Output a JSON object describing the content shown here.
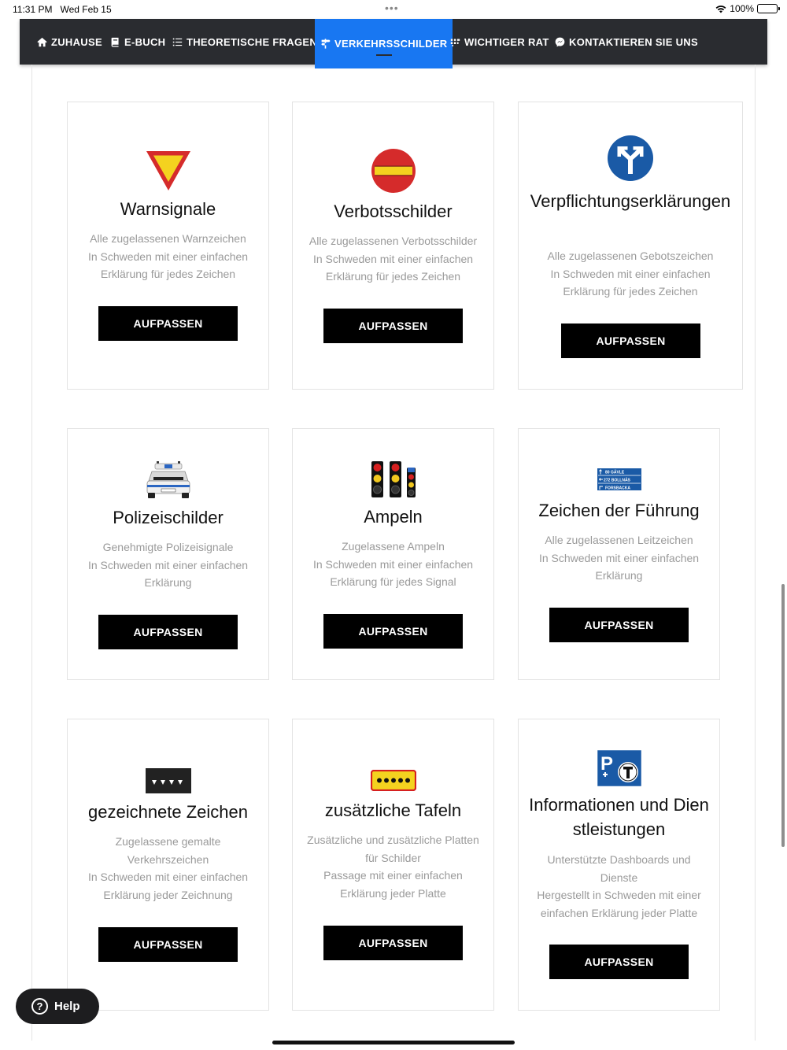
{
  "status_bar": {
    "time": "11:31 PM",
    "date": "Wed Feb 15",
    "battery": "100%"
  },
  "nav": {
    "items": [
      {
        "label": "ZUHAUSE",
        "icon": "home-icon"
      },
      {
        "label": "E-BUCH",
        "icon": "book-icon"
      },
      {
        "label": "THEORETISCHE FRAGEN",
        "icon": "list-icon"
      },
      {
        "label": "VERKEHRSSCHILDER",
        "icon": "signpost-icon",
        "active": true
      },
      {
        "label": "WICHTIGER RAT",
        "icon": "tips-icon"
      },
      {
        "label": "KONTAKTIEREN SIE UNS",
        "icon": "messenger-icon"
      }
    ],
    "accent_color": "#1877f2",
    "background_color": "#2a2c30"
  },
  "cards": [
    {
      "title": "Warnsignale",
      "description": [
        "Alle zugelassenen Warnzeichen",
        "In Schweden mit einer einfachen",
        "Erklärung für jedes Zeichen"
      ],
      "button": "AUFPASSEN",
      "icon": "warning-sign-icon"
    },
    {
      "title": "Verbotsschilder",
      "description": [
        "Alle zugelassenen Verbotsschilder",
        "In Schweden mit einer einfachen",
        "Erklärung für jedes Zeichen"
      ],
      "button": "AUFPASSEN",
      "icon": "no-entry-sign-icon"
    },
    {
      "title": "Verpflichtungserklärungen",
      "description": [
        "Alle zugelassenen Gebotszeichen",
        "In Schweden mit einer einfachen",
        "Erklärung für jedes Zeichen"
      ],
      "button": "AUFPASSEN",
      "icon": "mandatory-direction-sign-icon"
    },
    {
      "title": "Polizeischilder",
      "description": [
        "Genehmigte Polizeisignale",
        "In Schweden mit einer einfachen",
        "Erklärung"
      ],
      "button": "AUFPASSEN",
      "icon": "police-car-icon"
    },
    {
      "title": "Ampeln",
      "description": [
        "Zugelassene Ampeln",
        "In Schweden mit einer einfachen",
        "Erklärung für jedes Signal"
      ],
      "button": "AUFPASSEN",
      "icon": "traffic-lights-icon"
    },
    {
      "title": "Zeichen der Führung",
      "description": [
        "Alle zugelassenen Leitzeichen",
        "In Schweden mit einer einfachen",
        "Erklärung"
      ],
      "button": "AUFPASSEN",
      "icon": "direction-board-icon",
      "sign_text": [
        "80 GÄVLE",
        "272 BOLLNÄS",
        "FORSBACKA"
      ]
    },
    {
      "title": "gezeichnete Zeichen",
      "description": [
        "Zugelassene gemalte",
        "Verkehrszeichen",
        "In Schweden mit einer einfachen",
        "Erklärung jeder Zeichnung"
      ],
      "button": "AUFPASSEN",
      "icon": "road-marking-icon"
    },
    {
      "title": "zusätzliche Tafeln",
      "description": [
        "Zusätzliche und zusätzliche Platten",
        "für Schilder",
        "Passage mit einer einfachen",
        "Erklärung jeder Platte"
      ],
      "button": "AUFPASSEN",
      "icon": "additional-plate-icon"
    },
    {
      "title": "Informationen und Dienstleistungen",
      "description": [
        "Unterstützte Dashboards und",
        "Dienste",
        "Hergestellt in Schweden mit einer",
        "einfachen Erklärung jeder Platte"
      ],
      "button": "AUFPASSEN",
      "icon": "parking-info-sign-icon"
    }
  ],
  "help_button": {
    "label": "Help"
  }
}
